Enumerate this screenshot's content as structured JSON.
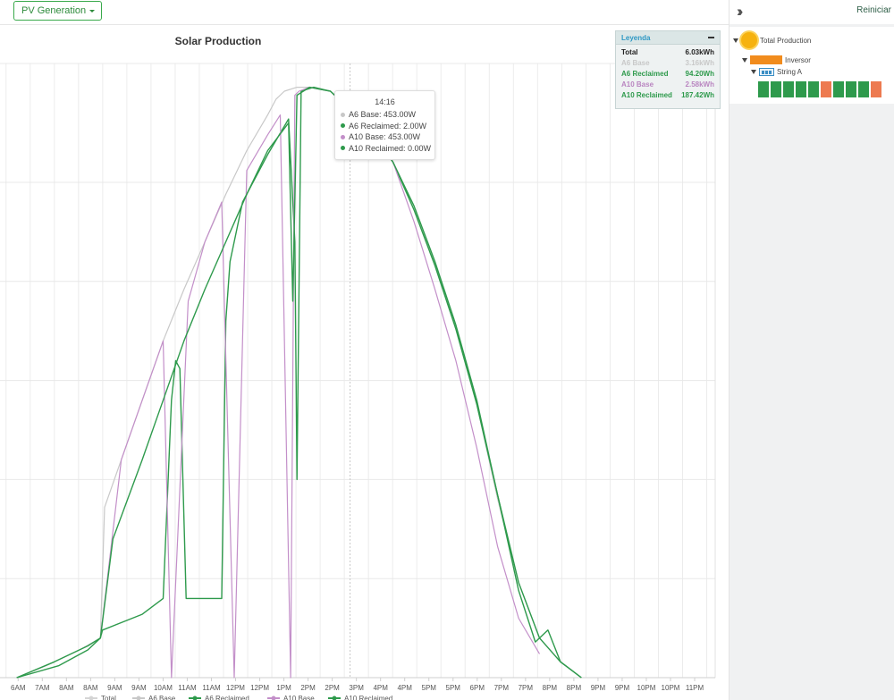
{
  "toolbar": {
    "view_button": "PV Generation"
  },
  "chart_title": "Solar Production",
  "tooltip": {
    "time": "14:16",
    "rows": [
      {
        "label": "A6 Base: 453.00W",
        "color": "#c8c8c8"
      },
      {
        "label": "A6 Reclaimed: 2.00W",
        "color": "#2e9a4c"
      },
      {
        "label": "A10 Base: 453.00W",
        "color": "#c38fc9"
      },
      {
        "label": "A10 Reclaimed: 0.00W",
        "color": "#2e9a4c"
      }
    ]
  },
  "legend": {
    "title": "Leyenda",
    "rows": [
      {
        "name": "Total",
        "value": "6.03kWh",
        "color": "#222222"
      },
      {
        "name": "A6 Base",
        "value": "3.16kWh",
        "color": "#c8c8c8"
      },
      {
        "name": "A6 Reclaimed",
        "value": "94.20Wh",
        "color": "#2e9a4c"
      },
      {
        "name": "A10 Base",
        "value": "2.58kWh",
        "color": "#b985c0"
      },
      {
        "name": "A10 Reclaimed",
        "value": "187.42Wh",
        "color": "#2e9a4c"
      }
    ]
  },
  "sidebar": {
    "reset": "Reiniciar",
    "tree": {
      "root": "Total Production",
      "inverter": "Inversor",
      "string": "String A"
    },
    "panels": [
      "green",
      "green",
      "green",
      "green",
      "green",
      "orange",
      "green",
      "green",
      "green",
      "orange"
    ]
  },
  "colors": {
    "green": "#2e9a4c",
    "orange": "#ed7a50",
    "a6_base": "#c8c8c8",
    "a10_base": "#c38fc9",
    "accent": "#39a94b"
  },
  "chart_data": {
    "type": "line",
    "x_ticks": [
      "6AM",
      "7AM",
      "8AM",
      "8AM",
      "9AM",
      "9AM",
      "10AM",
      "11AM",
      "11AM",
      "12PM",
      "12PM",
      "1PM",
      "2PM",
      "2PM",
      "3PM",
      "4PM",
      "4PM",
      "5PM",
      "5PM",
      "6PM",
      "7PM",
      "7PM",
      "8PM",
      "8PM",
      "9PM",
      "9PM",
      "10PM",
      "10PM",
      "11PM"
    ],
    "bottom_legend": [
      "Total",
      "A6 Base",
      "A6 Reclaimed",
      "A10 Base",
      "A10 Reclaimed"
    ],
    "series": [
      {
        "name": "A6 Base",
        "color": "#c8c8c8",
        "x": [
          6.3,
          7.0,
          7.8,
          8.3,
          8.4,
          8.8,
          9.3,
          9.8,
          10.3,
          10.8,
          11.3,
          11.8,
          12.3,
          12.5,
          12.7,
          13.0,
          13.3,
          13.8,
          14.3,
          14.8,
          15.3,
          15.8,
          16.3,
          16.8,
          17.3,
          17.8,
          18.3,
          18.8,
          19.3,
          19.8
        ],
        "y": [
          0.0,
          0.3,
          0.7,
          1.0,
          4.3,
          5.5,
          7.0,
          8.5,
          9.8,
          11.0,
          12.2,
          13.3,
          14.2,
          14.6,
          14.8,
          14.9,
          14.9,
          14.8,
          14.3,
          13.8,
          13.0,
          11.8,
          10.4,
          8.8,
          6.9,
          4.5,
          2.4,
          1.0,
          0.4,
          0.0
        ]
      },
      {
        "name": "A6 Reclaimed",
        "color": "#2e9a4c",
        "x": [
          6.3,
          7.2,
          8.0,
          8.3,
          8.35,
          9.3,
          9.8,
          10.0,
          10.1,
          10.2,
          10.35,
          11.2,
          11.3,
          11.4,
          11.7,
          12.3,
          12.8,
          12.95,
          13.0,
          13.1,
          13.4,
          13.8,
          14.3,
          14.8,
          15.3,
          15.8,
          16.3,
          16.8,
          17.3,
          17.8,
          18.3,
          18.8,
          19.3,
          19.8
        ],
        "y": [
          0.0,
          0.4,
          0.8,
          1.0,
          1.2,
          1.6,
          2.0,
          7.0,
          8.0,
          7.8,
          2.0,
          2.0,
          9.0,
          10.5,
          12.0,
          13.2,
          14.1,
          11.0,
          5.0,
          14.8,
          14.9,
          14.8,
          14.3,
          13.8,
          13.0,
          11.8,
          10.4,
          8.8,
          6.9,
          4.6,
          2.4,
          1.0,
          0.4,
          0.0
        ]
      },
      {
        "name": "A10 Base",
        "color": "#c38fc9",
        "x": [
          8.3,
          8.8,
          9.3,
          9.8,
          10.0,
          10.4,
          10.8,
          11.2,
          11.5,
          11.8,
          12.3,
          12.6,
          12.85,
          12.95,
          13.05,
          13.3,
          13.8,
          14.3,
          14.8,
          15.3,
          15.8,
          16.3,
          16.8,
          17.3,
          17.8,
          18.3,
          18.8
        ],
        "y": [
          1.0,
          5.5,
          7.0,
          8.5,
          0.0,
          9.5,
          11.0,
          12.0,
          0.0,
          12.8,
          13.7,
          14.2,
          0.0,
          14.7,
          14.8,
          14.9,
          14.8,
          14.3,
          13.8,
          13.0,
          11.5,
          9.8,
          8.0,
          5.8,
          3.3,
          1.5,
          0.6
        ]
      },
      {
        "name": "A10 Reclaimed",
        "color": "#2e9a4c",
        "x": [
          6.3,
          7.3,
          8.0,
          8.3,
          8.6,
          9.3,
          9.8,
          10.3,
          10.8,
          11.3,
          11.8,
          12.3,
          12.8,
          12.9,
          13.0,
          13.3,
          13.8,
          14.3,
          14.8,
          15.3,
          15.8,
          16.3,
          16.8,
          17.3,
          17.8,
          18.3,
          18.7,
          19.0,
          19.3,
          19.8
        ],
        "y": [
          0.0,
          0.3,
          0.7,
          1.0,
          3.5,
          5.5,
          7.0,
          8.5,
          9.8,
          11.0,
          12.2,
          13.3,
          14.0,
          9.5,
          14.7,
          14.9,
          14.8,
          14.3,
          13.8,
          13.0,
          11.9,
          10.5,
          8.9,
          7.0,
          4.6,
          2.2,
          0.9,
          1.2,
          0.4,
          0.0
        ]
      }
    ],
    "y_grid_levels": [
      2.5,
      5.0,
      7.5,
      10.0,
      12.5
    ],
    "ylim": [
      0,
      15.5
    ],
    "xlim": [
      5.9,
      23.0
    ],
    "hover_x": 14.27,
    "grid": true,
    "legend_position": "bottom"
  }
}
